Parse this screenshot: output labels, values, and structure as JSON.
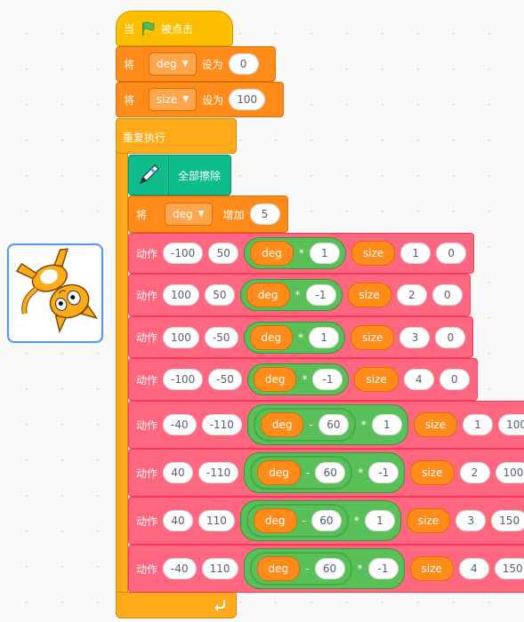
{
  "event": {
    "when_label": "当",
    "flag_icon": "green-flag-icon",
    "clicked_label": "被点击"
  },
  "set_deg": {
    "label": "将",
    "variable": "deg",
    "to_label": "设为",
    "value": "0"
  },
  "set_size": {
    "label": "将",
    "variable": "size",
    "to_label": "设为",
    "value": "100"
  },
  "forever": {
    "label": "重复执行",
    "loop_icon": "loop-arrow-icon"
  },
  "pen_clear": {
    "pen_icon": "pen-icon",
    "label": "全部擦除"
  },
  "change_deg": {
    "label": "将",
    "variable": "deg",
    "by_label": "增加",
    "value": "5"
  },
  "action_label": "动作",
  "actions": [
    {
      "a": "-100",
      "b": "50",
      "expr": [
        {
          "type": "var",
          "v": "deg"
        },
        {
          "type": "sym",
          "v": "*"
        },
        {
          "type": "num",
          "v": "1"
        }
      ],
      "var": "size",
      "c": "1",
      "d": "0"
    },
    {
      "a": "100",
      "b": "50",
      "expr": [
        {
          "type": "var",
          "v": "deg"
        },
        {
          "type": "sym",
          "v": "*"
        },
        {
          "type": "num",
          "v": "-1"
        }
      ],
      "var": "size",
      "c": "2",
      "d": "0"
    },
    {
      "a": "100",
      "b": "-50",
      "expr": [
        {
          "type": "var",
          "v": "deg"
        },
        {
          "type": "sym",
          "v": "*"
        },
        {
          "type": "num",
          "v": "1"
        }
      ],
      "var": "size",
      "c": "3",
      "d": "0"
    },
    {
      "a": "-100",
      "b": "-50",
      "expr": [
        {
          "type": "var",
          "v": "deg"
        },
        {
          "type": "sym",
          "v": "*"
        },
        {
          "type": "num",
          "v": "-1"
        }
      ],
      "var": "size",
      "c": "4",
      "d": "0"
    },
    {
      "a": "-40",
      "b": "-110",
      "expr": [
        {
          "type": "var",
          "v": "deg"
        },
        {
          "type": "sym",
          "v": "-"
        },
        {
          "type": "num",
          "v": "60"
        },
        {
          "type": "sym",
          "v": "*"
        },
        {
          "type": "num",
          "v": "1"
        }
      ],
      "var": "size",
      "c": "1",
      "d": "100"
    },
    {
      "a": "40",
      "b": "-110",
      "expr": [
        {
          "type": "var",
          "v": "deg"
        },
        {
          "type": "sym",
          "v": "-"
        },
        {
          "type": "num",
          "v": "60"
        },
        {
          "type": "sym",
          "v": "*"
        },
        {
          "type": "num",
          "v": "-1"
        }
      ],
      "var": "size",
      "c": "2",
      "d": "100"
    },
    {
      "a": "40",
      "b": "110",
      "expr": [
        {
          "type": "var",
          "v": "deg"
        },
        {
          "type": "sym",
          "v": "-"
        },
        {
          "type": "num",
          "v": "60"
        },
        {
          "type": "sym",
          "v": "*"
        },
        {
          "type": "num",
          "v": "1"
        }
      ],
      "var": "size",
      "c": "3",
      "d": "150"
    },
    {
      "a": "-40",
      "b": "110",
      "expr": [
        {
          "type": "var",
          "v": "deg"
        },
        {
          "type": "sym",
          "v": "-"
        },
        {
          "type": "num",
          "v": "60"
        },
        {
          "type": "sym",
          "v": "*"
        },
        {
          "type": "num",
          "v": "-1"
        }
      ],
      "var": "size",
      "c": "4",
      "d": "150"
    }
  ],
  "colors": {
    "event": "#ffbf00",
    "variables": "#ff8c1a",
    "control": "#ffab19",
    "pen": "#0fbd8c",
    "custom": "#ff6680",
    "operators": "#59c059",
    "sprite_border": "#4c97ff"
  },
  "sprite": {
    "name_icon": "scratch-cat-sprite-icon"
  }
}
